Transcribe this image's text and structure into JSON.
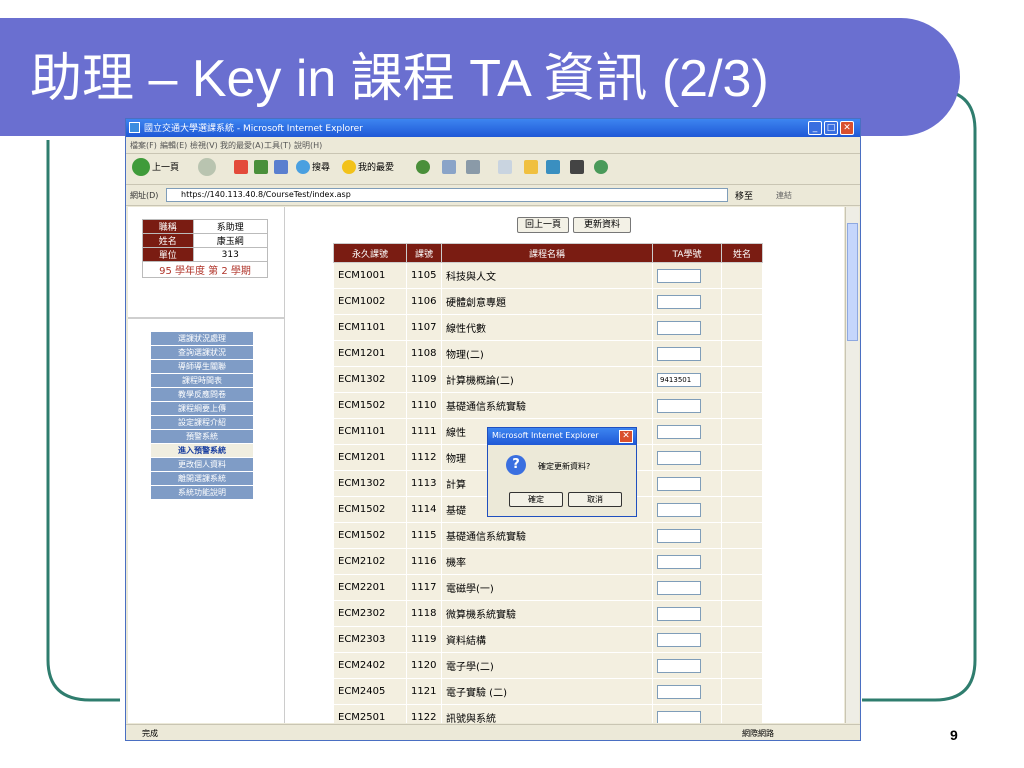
{
  "slide": {
    "title": "助理 – Key in 課程 TA 資訊 (2/3)",
    "page_number": "9"
  },
  "browser": {
    "title": "國立交通大學選課系統 - Microsoft Internet Explorer",
    "menu": [
      "檔案(F)",
      "編輯(E)",
      "檢視(V)",
      "我的最愛(A)",
      "工具(T)",
      "說明(H)"
    ],
    "toolbar": {
      "back_label": "上一頁",
      "search_label": "搜尋",
      "favorites_label": "我的最愛"
    },
    "address_label": "網址(D)",
    "address": "https://140.113.40.8/CourseTest/index.asp",
    "go_label": "移至",
    "links_label": "連結",
    "status": "完成",
    "zone": "網際網路"
  },
  "user_info": {
    "rows": [
      {
        "label": "職稱",
        "value": "系助理"
      },
      {
        "label": "姓名",
        "value": "康玉綱"
      },
      {
        "label": "單位",
        "value": "313"
      }
    ],
    "term": "95 學年度 第 2 學期"
  },
  "sidebar_links": [
    "選課狀況處理",
    "查詢選課狀況",
    "導師導生關聯",
    "課程時間表",
    "教學反應問卷",
    "課程綱要上傳",
    "設定課程介紹",
    "預警系統",
    "進入預警系統",
    "更改個人資料",
    "離開選課系統",
    "系統功能說明"
  ],
  "page_buttons": {
    "back": "回上一頁",
    "update": "更新資料"
  },
  "table": {
    "headers": [
      "永久課號",
      "課號",
      "課程名稱",
      "TA學號",
      "姓名"
    ],
    "rows": [
      {
        "perm": "ECM1001",
        "num": "1105",
        "name": "科技與人文",
        "ta": "",
        "student_name": ""
      },
      {
        "perm": "ECM1002",
        "num": "1106",
        "name": "硬體創意專題",
        "ta": "",
        "student_name": ""
      },
      {
        "perm": "ECM1101",
        "num": "1107",
        "name": "線性代數",
        "ta": "",
        "student_name": ""
      },
      {
        "perm": "ECM1201",
        "num": "1108",
        "name": "物理(二)",
        "ta": "",
        "student_name": ""
      },
      {
        "perm": "ECM1302",
        "num": "1109",
        "name": "計算機概論(二)",
        "ta": "9413501",
        "student_name": ""
      },
      {
        "perm": "ECM1502",
        "num": "1110",
        "name": "基礎通信系統實驗",
        "ta": "",
        "student_name": ""
      },
      {
        "perm": "ECM1101",
        "num": "1111",
        "name": "線性",
        "ta": "",
        "student_name": ""
      },
      {
        "perm": "ECM1201",
        "num": "1112",
        "name": "物理",
        "ta": "",
        "student_name": ""
      },
      {
        "perm": "ECM1302",
        "num": "1113",
        "name": "計算",
        "ta": "",
        "student_name": ""
      },
      {
        "perm": "ECM1502",
        "num": "1114",
        "name": "基礎",
        "ta": "",
        "student_name": ""
      },
      {
        "perm": "ECM1502",
        "num": "1115",
        "name": "基礎通信系統實驗",
        "ta": "",
        "student_name": ""
      },
      {
        "perm": "ECM2102",
        "num": "1116",
        "name": "機率",
        "ta": "",
        "student_name": ""
      },
      {
        "perm": "ECM2201",
        "num": "1117",
        "name": "電磁學(一)",
        "ta": "",
        "student_name": ""
      },
      {
        "perm": "ECM2302",
        "num": "1118",
        "name": "微算機系統實驗",
        "ta": "",
        "student_name": ""
      },
      {
        "perm": "ECM2303",
        "num": "1119",
        "name": "資料結構",
        "ta": "",
        "student_name": ""
      },
      {
        "perm": "ECM2402",
        "num": "1120",
        "name": "電子學(二)",
        "ta": "",
        "student_name": ""
      },
      {
        "perm": "ECM2405",
        "num": "1121",
        "name": "電子實驗 (二)",
        "ta": "",
        "student_name": ""
      },
      {
        "perm": "ECM2501",
        "num": "1122",
        "name": "訊號與系統",
        "ta": "",
        "student_name": ""
      }
    ]
  },
  "dialog": {
    "title": "Microsoft Internet Explorer",
    "message": "確定更新資料?",
    "ok_label": "確定",
    "cancel_label": "取消"
  },
  "colors": {
    "banner": "#6a6fd0",
    "outline": "#2f7d6e",
    "table_header": "#7a1c12",
    "row_bg": "#f3efe0"
  }
}
